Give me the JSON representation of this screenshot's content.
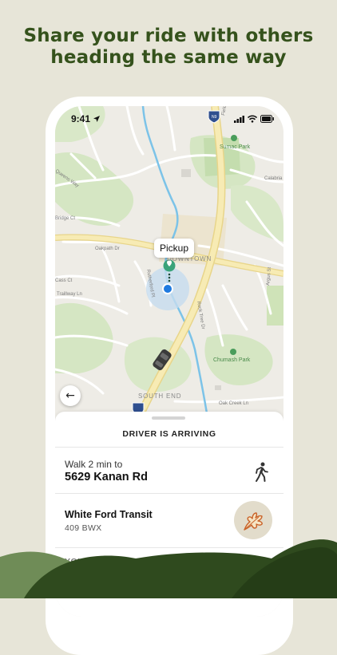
{
  "headline": {
    "line1": "Share your ride with others",
    "line2": "heading the same way"
  },
  "status_bar": {
    "time": "9:41",
    "icons": [
      "location-arrow-icon",
      "signal-icon",
      "wifi-icon",
      "battery-icon"
    ]
  },
  "map": {
    "pickup_label": "Pickup",
    "labels": {
      "downtown": "DOWNTOWN",
      "south_end": "SOUTH END",
      "sumac_park": "Sumac Park",
      "chumash_park": "Chumash Park",
      "oakpath": "Oakpath Dr",
      "traillway": "Traillway Ln",
      "oak_creek": "Oak Creek Ln",
      "highway": "N9",
      "rutherford": "Rutherford Pl",
      "rock_tree": "Rock Tree Dr",
      "aspen": "Argus St",
      "calabria": "Calabria",
      "cass": "Cass Ct",
      "queens": "Queens Way",
      "bridge": "Bridge Ct",
      "falcon": "Field Rd"
    }
  },
  "sheet": {
    "status_title": "DRIVER IS ARRIVING",
    "walk_text": "Walk 2 min to",
    "address": "5629 Kanan Rd",
    "vehicle": "White Ford Transit",
    "plate": "409 BWX",
    "section_your_trip": "YOUR TRIP"
  },
  "colors": {
    "background": "#e7e5d8",
    "headline": "#35521c",
    "pickup_pin": "#3aa37a",
    "user_dot": "#1f7ae0",
    "road_major": "#f5e6a8",
    "park": "#cfe3b8",
    "river": "#7cc3e8",
    "hill_dark": "#2f4a1e",
    "hill_mid": "#516d39"
  }
}
